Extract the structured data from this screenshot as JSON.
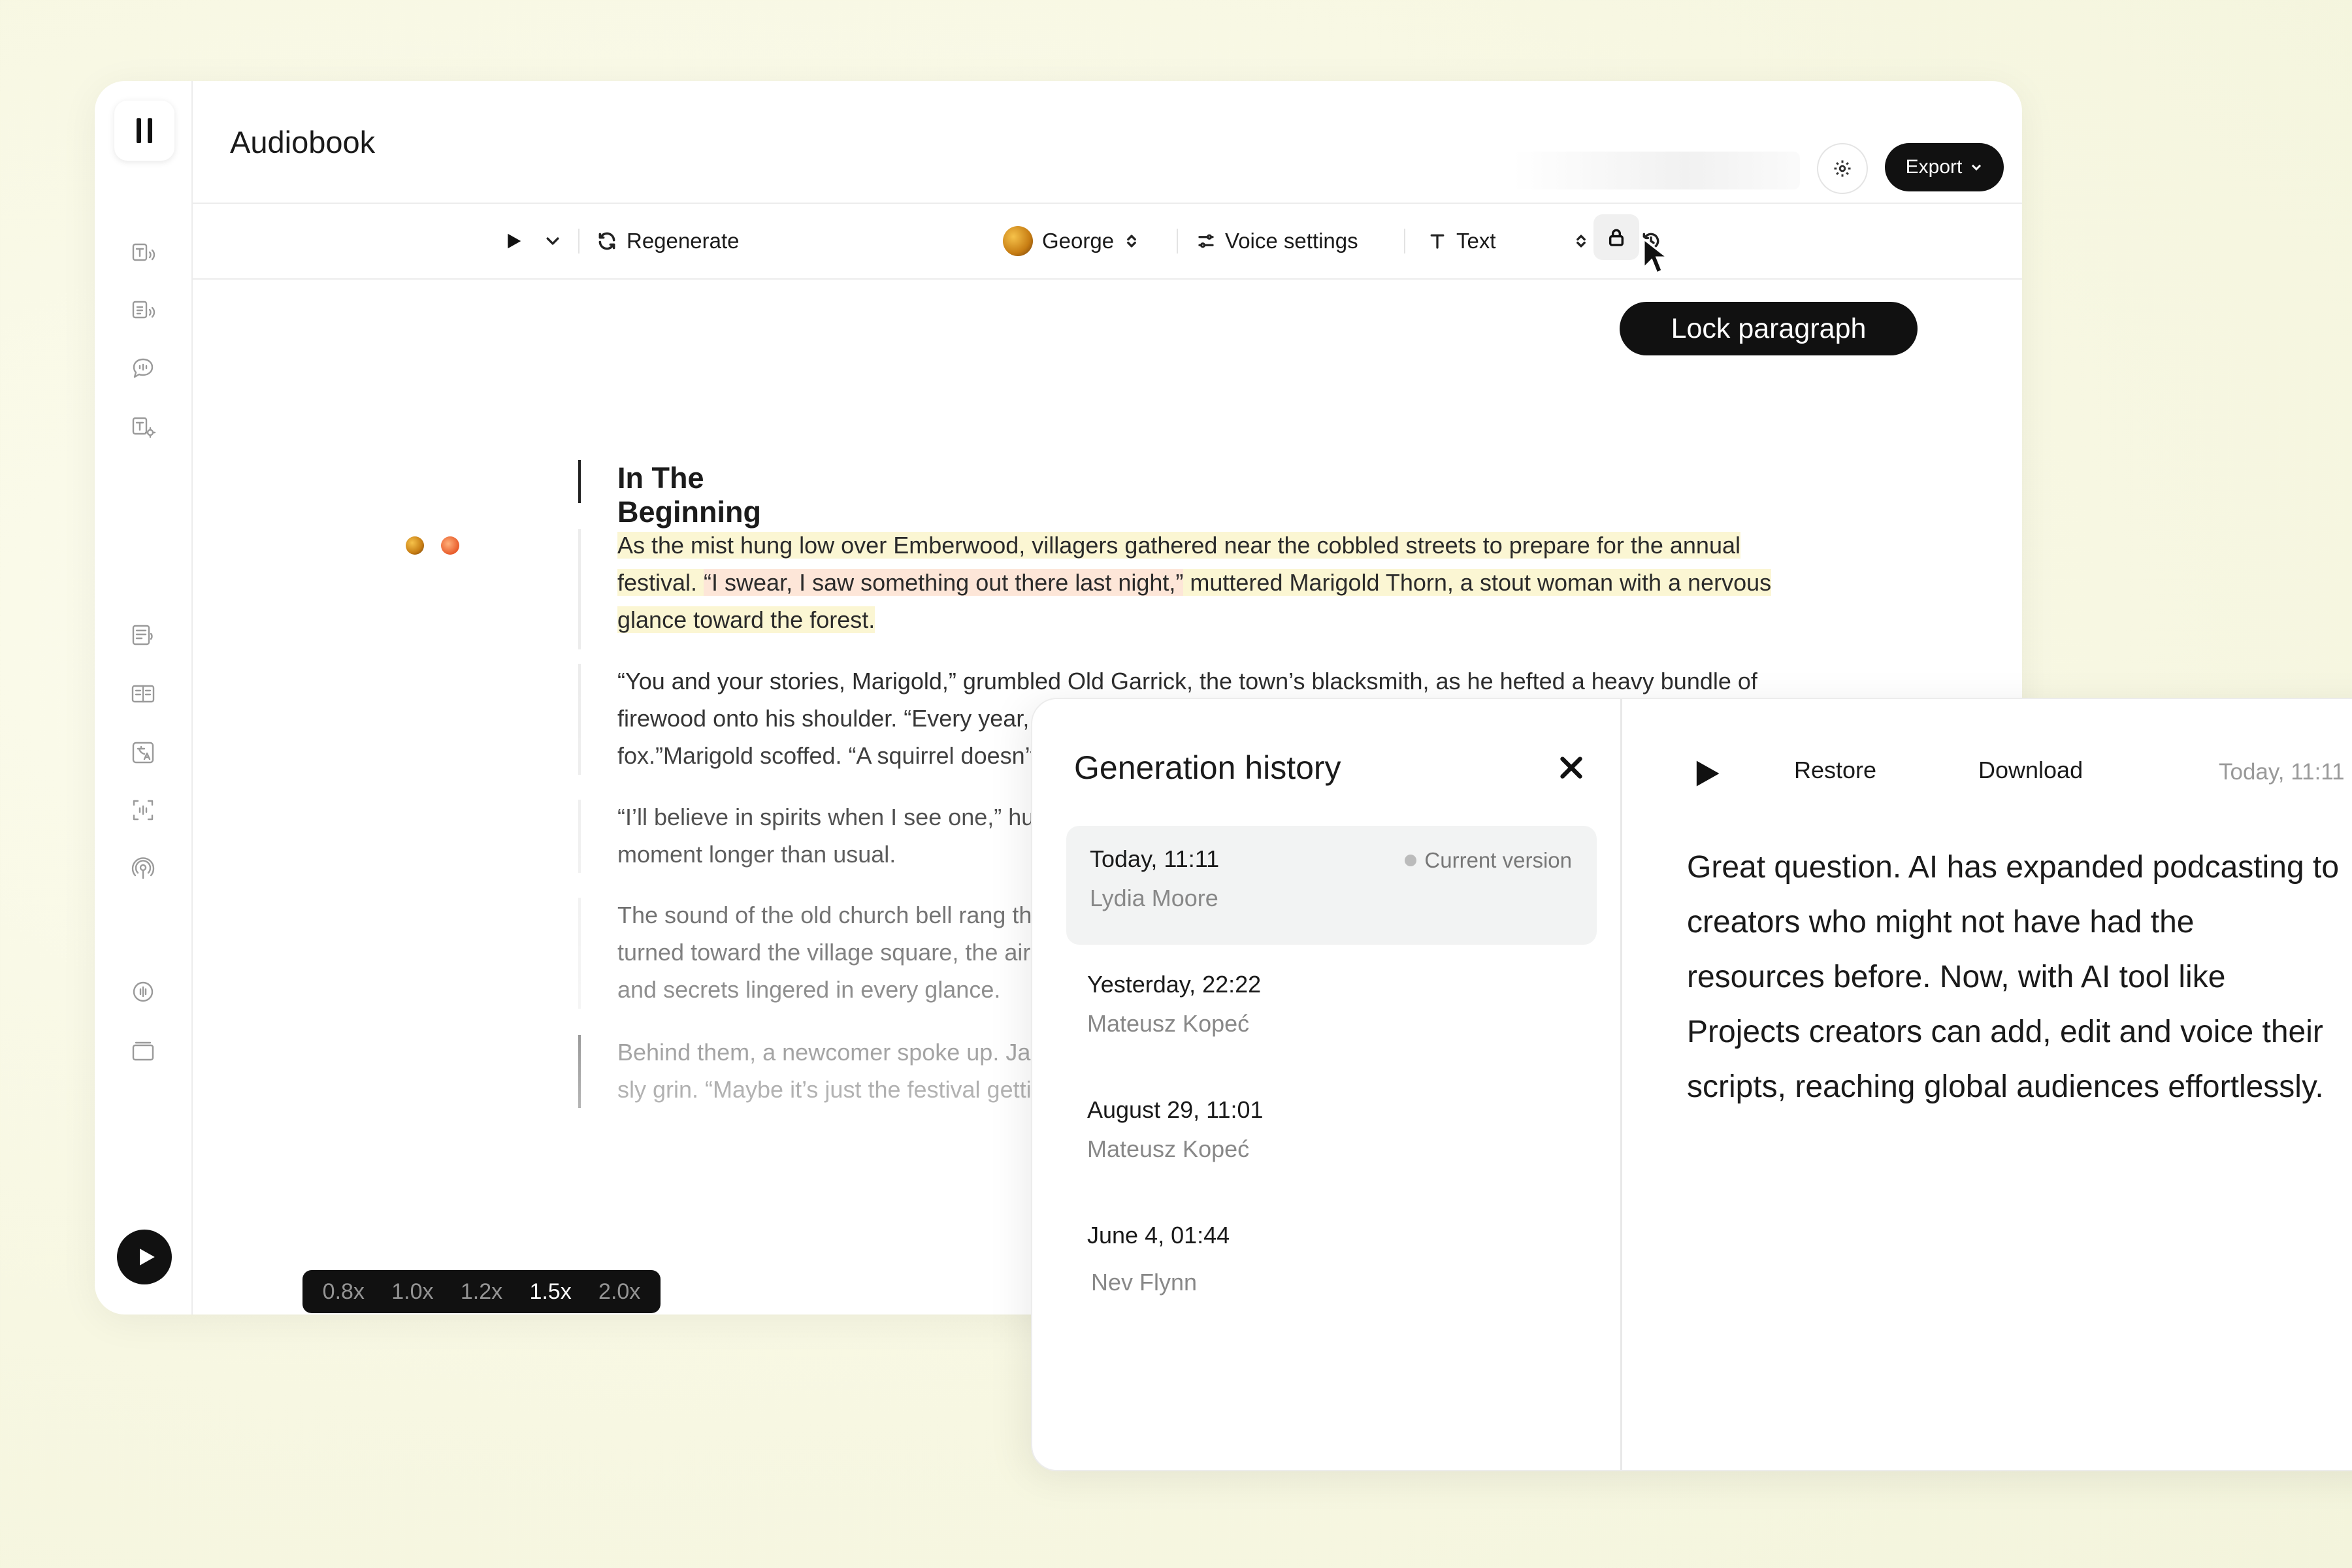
{
  "app": {
    "title": "Audiobook"
  },
  "header": {
    "export_label": "Export"
  },
  "toolbar": {
    "regenerate_label": "Regenerate",
    "voice_name": "George",
    "voice_settings_label": "Voice settings",
    "text_label": "Text"
  },
  "tooltip": {
    "lock_paragraph": "Lock paragraph"
  },
  "document": {
    "heading": "In The Beginning",
    "p1_a": "As the mist hung low over Emberwood, villagers gathered near the cobbled streets to prepare for the annual festival. ",
    "p1_b": "“I swear, I saw something out there last night,”",
    "p1_c": " muttered Marigold Thorn, a stout woman with a nervous glance toward the forest.",
    "p2": "“You and your stories, Marigold,” grumbled Old Garrick, the town’s blacksmith, as he hefted a heavy bundle of firewood onto his shoulder. “Every year, you say the same thing, and every year, it’s just a squirrel or some wild fox.”Marigold scoffed. “A squirrel doesn’t have a shadow tall as a man.”",
    "p3_l1": "“I’ll believe in spirits when I see one,” huffec",
    "p3_l2": "moment longer than usual.",
    "p4_l1": "The sound of the old church bell rang throu",
    "p4_l2": "turned toward the village square, the air gre",
    "p4_l3": "and secrets lingered in every glance.",
    "p5_l1": "Behind them, a newcomer spoke up. Jamie",
    "p5_l2": "sly grin. “Maybe it’s just the festival getting"
  },
  "player": {
    "speeds": [
      "0.8x",
      "1.0x",
      "1.2x",
      "1.5x",
      "2.0x"
    ],
    "active_speed": "1.5x",
    "progress": 0.055
  },
  "history": {
    "title": "Generation history",
    "entries": [
      {
        "date": "Today, 11:11",
        "author": "Lydia Moore",
        "badge": "Current version"
      },
      {
        "date": "Yesterday, 22:22",
        "author": "Mateusz Kopeć"
      },
      {
        "date": "August 29, 11:01",
        "author": "Mateusz Kopeć"
      },
      {
        "date": "June 4, 01:44",
        "author": "Nev Flynn"
      }
    ],
    "preview": {
      "restore_label": "Restore",
      "download_label": "Download",
      "date": "Today, 11:11",
      "text": "Great question. AI has expanded podcasting to creators who might not have had the resources before. Now, with AI tool like Projects creators can add, edit and voice their scripts, reaching global audiences effortlessly."
    }
  },
  "colors": {
    "accent": "#111111",
    "highlight_yellow": "#fbf6d3",
    "highlight_peach": "#fde6d8"
  }
}
